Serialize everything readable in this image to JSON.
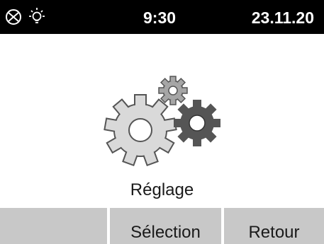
{
  "status": {
    "icons": [
      "no-signal-icon",
      "light-bulb-icon"
    ],
    "time": "9:30",
    "date": "23.11.20"
  },
  "main": {
    "icon": "gears-icon",
    "title": "Réglage"
  },
  "softkeys": [
    {
      "label": ""
    },
    {
      "label": "Sélection"
    },
    {
      "label": "Retour"
    }
  ],
  "colors": {
    "statusbar": "#000000",
    "softkey_bg": "#c8c8c8",
    "gear_light": "#d9d9d9",
    "gear_mid": "#a6a6a6",
    "gear_dark": "#555555"
  }
}
